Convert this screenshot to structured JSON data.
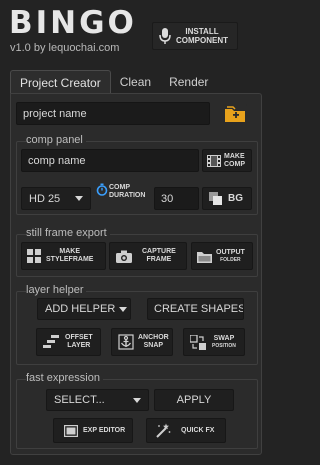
{
  "header": {
    "logo": "BINGO",
    "version": "v1.0 by lequochai.com",
    "install_label": "INSTALL\nCOMPONENT"
  },
  "tabs": [
    {
      "label": "Project Creator",
      "active": true
    },
    {
      "label": "Clean",
      "active": false
    },
    {
      "label": "Render",
      "active": false
    }
  ],
  "project": {
    "name_value": "project name",
    "folder_icon": "folder-plus-icon",
    "accent": "#e8a21c"
  },
  "comp_panel": {
    "label": "comp panel",
    "name_value": "comp name",
    "make_comp_label": "MAKE\nCOMP",
    "resolution": "HD 25",
    "duration_label": "COMP\nDURATION",
    "duration_value": "30",
    "bg_label": "BG"
  },
  "still_frame": {
    "label": "still frame export",
    "make_styleframe": "MAKE\nSTYLEFRAME",
    "capture_frame": "CAPTURE\nFRAME",
    "output_folder_main": "OUTPUT",
    "output_folder_sub": "FOLDER"
  },
  "layer_helper": {
    "label": "layer helper",
    "add_helper": "ADD HELPER",
    "create_shapes": "CREATE SHAPES",
    "offset_layer": "OFFSET\nLAYER",
    "anchor_snap": "ANCHOR\nSNAP",
    "swap_main": "SWAP",
    "swap_sub": "POSITION"
  },
  "fast_expression": {
    "label": "fast expression",
    "select": "SELECT...",
    "apply": "APPLY",
    "exp_editor": "EXP EDITOR",
    "quick_fx": "QUICK FX"
  }
}
